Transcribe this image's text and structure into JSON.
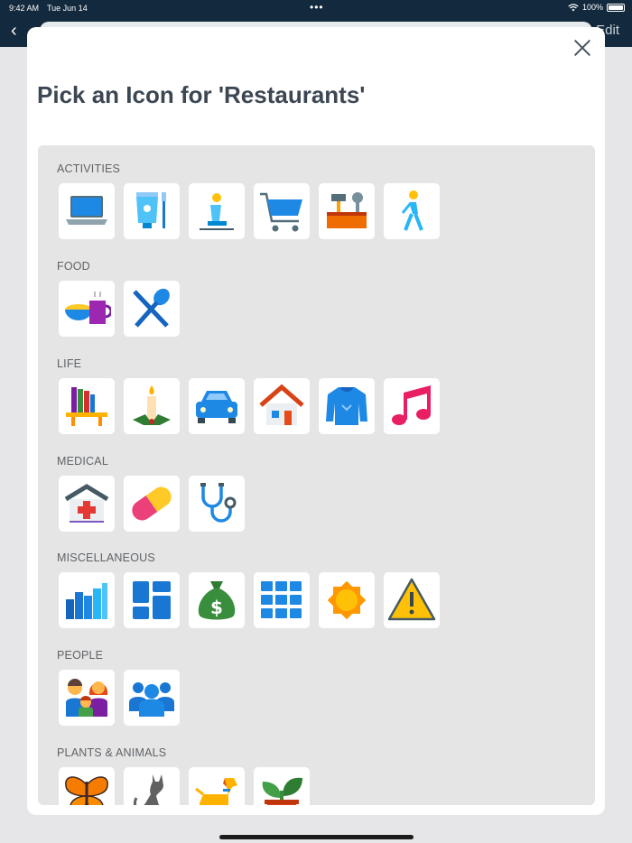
{
  "status_bar": {
    "time": "9:42 AM",
    "date": "Tue Jun 14",
    "battery": "100%"
  },
  "nav": {
    "edit_label": "Edit"
  },
  "sheet": {
    "title": "Pick an Icon for 'Restaurants'"
  },
  "sections": [
    {
      "label": "ACTIVITIES",
      "icons": [
        "laptop-icon",
        "toothpaste-icon",
        "prayer-icon",
        "shopping-cart-icon",
        "toolbox-icon",
        "walking-icon"
      ]
    },
    {
      "label": "FOOD",
      "icons": [
        "breakfast-icon",
        "restaurant-utensils-icon"
      ]
    },
    {
      "label": "LIFE",
      "icons": [
        "bookshelf-icon",
        "candle-icon",
        "car-icon",
        "house-icon",
        "sweater-icon",
        "music-note-icon"
      ]
    },
    {
      "label": "MEDICAL",
      "icons": [
        "hospital-icon",
        "pill-icon",
        "stethoscope-icon"
      ]
    },
    {
      "label": "MISCELLANEOUS",
      "icons": [
        "bar-chart-icon",
        "dashboard-icon",
        "money-bag-icon",
        "grid-icon",
        "sun-icon",
        "warning-icon"
      ]
    },
    {
      "label": "PEOPLE",
      "icons": [
        "family-icon",
        "group-icon"
      ]
    },
    {
      "label": "PLANTS & ANIMALS",
      "icons": [
        "butterfly-icon",
        "cat-icon",
        "dog-icon",
        "plant-icon"
      ]
    }
  ]
}
